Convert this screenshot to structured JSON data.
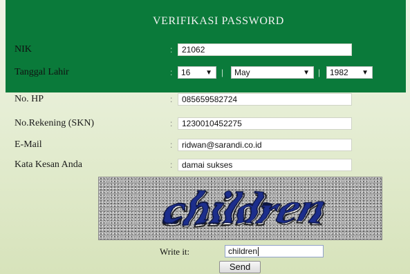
{
  "title": "VERIFIKASI PASSWORD",
  "colon": ":",
  "separator": "|",
  "fields": {
    "nik": {
      "label": "NIK",
      "value": "21062"
    },
    "tanggal_lahir": {
      "label": "Tanggal Lahir",
      "day": "16",
      "month": "May",
      "year": "1982"
    },
    "no_hp": {
      "label": "No. HP",
      "value": "085659582724"
    },
    "no_rekening": {
      "label": "No.Rekening (SKN)",
      "value": "1230010452275"
    },
    "email": {
      "label": "E-Mail",
      "value": "ridwan@sarandi.co.id"
    },
    "kesan": {
      "label": "Kata Kesan Anda",
      "value": "damai sukses"
    }
  },
  "captcha": {
    "text": "children"
  },
  "write_it": {
    "label": "Write it:",
    "value": "children"
  },
  "send_label": "Send",
  "colors": {
    "header_green": "#0a7a3a",
    "captcha_text": "#1f2f8c",
    "captcha_noise": "#a7a7a7"
  },
  "icons": {
    "dropdown_arrow": "triangle-down"
  }
}
